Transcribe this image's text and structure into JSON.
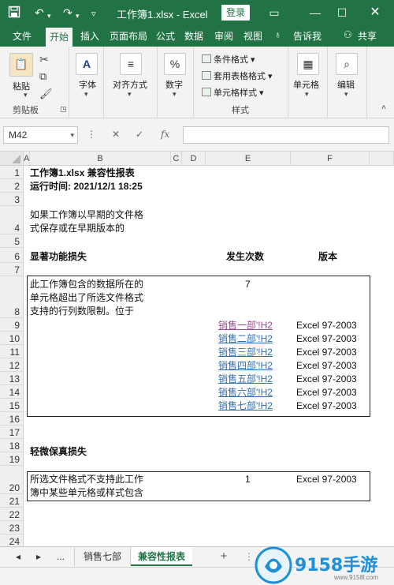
{
  "titlebar": {
    "title": "工作簿1.xlsx  -  Excel",
    "login_label": "登录",
    "bg_color": "#217346"
  },
  "tabs": [
    {
      "label": "文件"
    },
    {
      "label": "开始"
    },
    {
      "label": "插入"
    },
    {
      "label": "页面布局"
    },
    {
      "label": "公式"
    },
    {
      "label": "数据"
    },
    {
      "label": "审阅"
    },
    {
      "label": "视图"
    }
  ],
  "tell_me": "告诉我",
  "share": "共享",
  "ribbon": {
    "paste_label": "粘贴",
    "clipboard_group": "剪贴板",
    "font_label": "字体",
    "align_label": "对齐方式",
    "number_label": "数字",
    "cond_format": "条件格式",
    "table_format": "套用表格格式",
    "cell_style": "单元格样式",
    "style_group": "样式",
    "cells_label": "单元格",
    "edit_label": "编辑"
  },
  "formula_bar": {
    "name_box": "M42",
    "fx": "fx",
    "cancel": "✕",
    "enter": "✓"
  },
  "columns": [
    "A",
    "B",
    "C",
    "D",
    "E",
    "F"
  ],
  "rows": [
    "1",
    "2",
    "3",
    "4",
    "5",
    "6",
    "7",
    "8",
    "9",
    "10",
    "11",
    "12",
    "13",
    "14",
    "15",
    "16",
    "17",
    "18",
    "19",
    "20",
    "21",
    "22",
    "23",
    "24"
  ],
  "report": {
    "title": "工作簿1.xlsx 兼容性报表",
    "run_time": "运行时间: 2021/12/1 18:25",
    "intro_line1": "如果工作簿以早期的文件格",
    "intro_line2": "式保存或在早期版本的",
    "section1": "显著功能损失",
    "col_count": "发生次数",
    "col_version": "版本",
    "issue1_line1": "此工作簿包含的数据所在的",
    "issue1_line2": "单元格超出了所选文件格式",
    "issue1_line3": "支持的行列数限制。位于",
    "issue1_count": "7",
    "links": [
      {
        "text": "销售一部'!H2",
        "version": "Excel 97-2003"
      },
      {
        "text": "销售二部'!H2",
        "version": "Excel 97-2003"
      },
      {
        "text": "销售三部'!H2",
        "version": "Excel 97-2003"
      },
      {
        "text": "销售四部'!H2",
        "version": "Excel 97-2003"
      },
      {
        "text": "销售五部'!H2",
        "version": "Excel 97-2003"
      },
      {
        "text": "销售六部'!H2",
        "version": "Excel 97-2003"
      },
      {
        "text": "销售七部'!H2",
        "version": "Excel 97-2003"
      }
    ],
    "section2": "轻微保真损失",
    "issue2_line1": "所选文件格式不支持此工作",
    "issue2_line2": "簿中某些单元格或样式包含",
    "issue2_count": "1",
    "issue2_version": "Excel 97-2003"
  },
  "sheet_tabs": {
    "ellipsis": "...",
    "tab1": "销售七部",
    "tab2": "兼容性报表",
    "add": "+"
  },
  "watermark": {
    "brand": "9158手游",
    "site": "www.9158l.com"
  }
}
